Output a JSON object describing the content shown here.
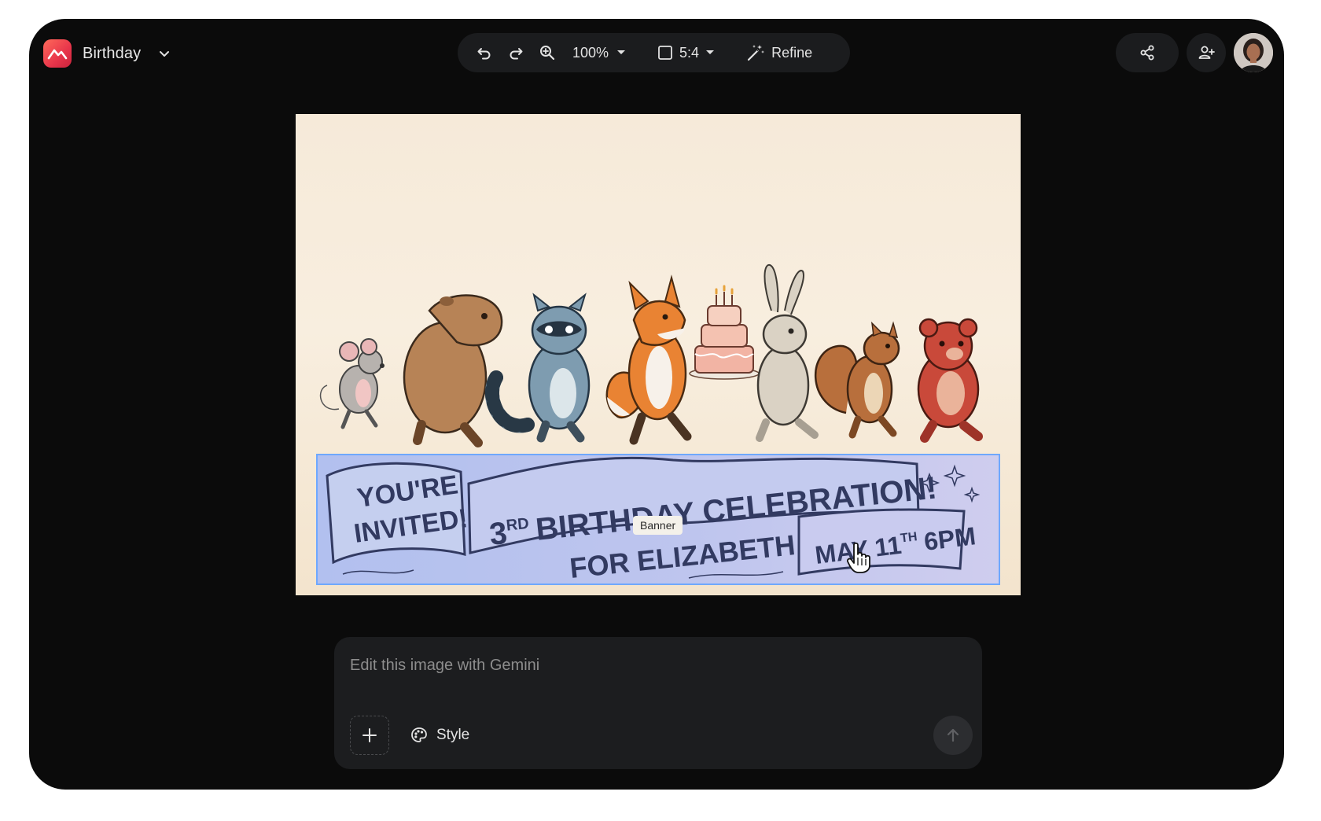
{
  "app": {
    "title": "Birthday"
  },
  "toolbar": {
    "undo_icon": "undo-icon",
    "redo_icon": "redo-icon",
    "zoom_icon": "zoom-in-icon",
    "zoom_level": "100%",
    "aspect_ratio": "5:4",
    "refine_label": "Refine"
  },
  "canvas": {
    "tooltip": "Banner",
    "banner": {
      "left_text": [
        "YOU'RE",
        "INVITED!"
      ],
      "center_line1_prefix": "3",
      "center_line1_sup": "RD",
      "center_line1_rest": "BIRTHDAY CELEBRATION!",
      "center_line2": "FOR ELIZABETH",
      "date_main": "MAY 11",
      "date_sup": "TH",
      "date_time": "6PM"
    },
    "animals": [
      "mouse",
      "capybara",
      "raccoon",
      "fox",
      "rabbit",
      "squirrel",
      "bear"
    ]
  },
  "prompt": {
    "placeholder": "Edit this image with Gemini",
    "value": "",
    "style_label": "Style"
  },
  "colors": {
    "window_bg": "#0b0b0b",
    "pill_bg": "#1b1c1e",
    "accent_logo": "#e8354b",
    "selection": "#6fa8ff"
  }
}
